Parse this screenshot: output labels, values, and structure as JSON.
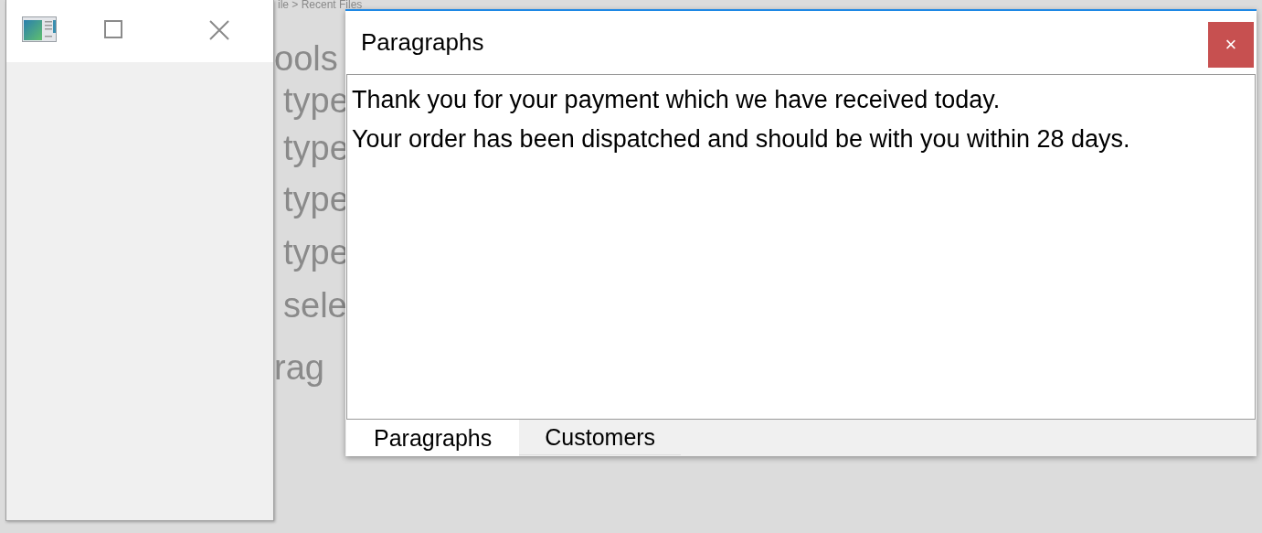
{
  "background": {
    "texts": [
      "ile > Recent Files",
      "ools",
      "type",
      "type",
      "type",
      "type",
      "sele",
      "rag"
    ]
  },
  "dialog": {
    "title": "Paragraphs",
    "close_label": "×",
    "lines": [
      "Thank you for your payment which we have received today.",
      "Your order has been dispatched and should be with you within 28 days."
    ],
    "tabs": [
      {
        "label": "Paragraphs",
        "selected": true
      },
      {
        "label": "Customers",
        "selected": false
      }
    ]
  }
}
